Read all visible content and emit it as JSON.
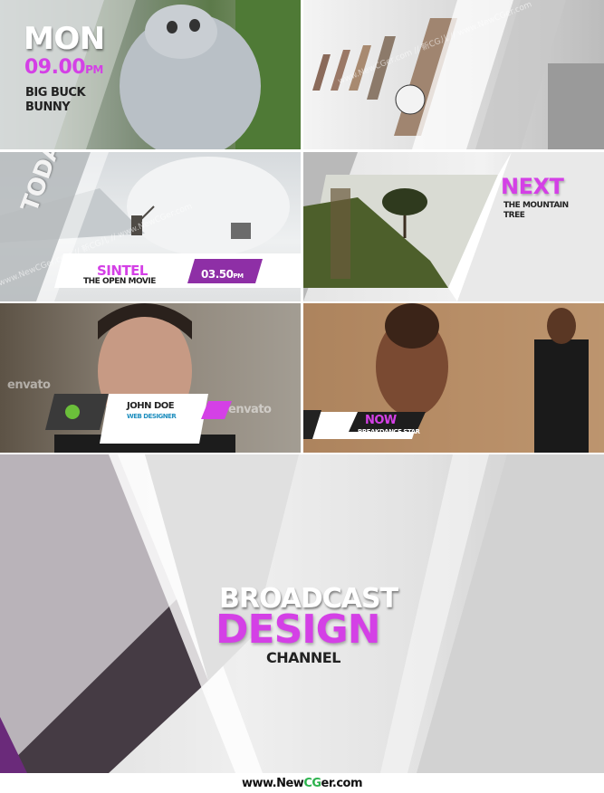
{
  "panel1": {
    "day": "MON",
    "time": "09.00",
    "time_suffix": "PM",
    "title_line1": "BIG BUCK",
    "title_line2": "BUNNY"
  },
  "panel3": {
    "vertical": "TODAY",
    "title": "SINTEL",
    "subtitle": "THE OPEN MOVIE",
    "time": "03.50",
    "time_suffix": "PM"
  },
  "panel4": {
    "heading": "NEXT",
    "line1": "THE MOUNTAIN",
    "line2": "TREE"
  },
  "panel5": {
    "name": "JOHN DOE",
    "role": "WEB DESIGNER",
    "watermark": "envato"
  },
  "panel6": {
    "heading": "NOW",
    "subtitle": "BREAKDANCE STAR"
  },
  "panel7": {
    "line1": "BROADCAST",
    "line2": "DESIGN",
    "line3": "CHANNEL"
  },
  "watermark_text": "www.NewCGer.com // 新CG儿 // www.NewCGer.com",
  "footer": {
    "prefix": "www.",
    "brand_a": "New",
    "brand_b": "CG",
    "brand_c": "er",
    "suffix": ".com"
  },
  "colors": {
    "accent": "#d440e6",
    "dark": "#222222"
  }
}
